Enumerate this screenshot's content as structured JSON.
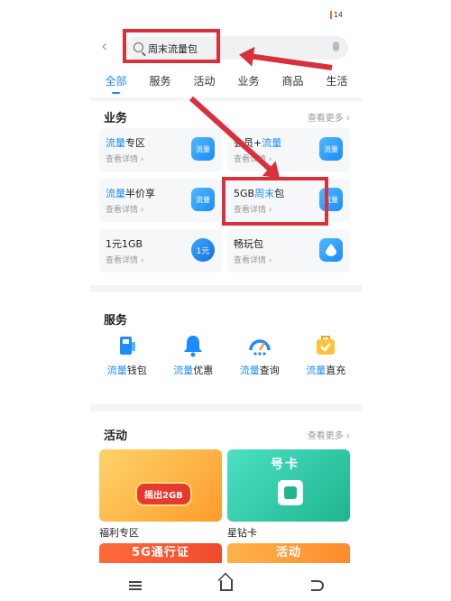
{
  "status": {
    "battery": "14"
  },
  "search": {
    "query": "周末流量包"
  },
  "tabs": [
    "全部",
    "服务",
    "活动",
    "业务",
    "商品",
    "生活"
  ],
  "business": {
    "title": "业务",
    "more": "查看更多",
    "cards": [
      {
        "hl": "流量",
        "rest": "专区",
        "detail": "查看详情",
        "icon": "流量"
      },
      {
        "pre": "会员+",
        "hl": "流量",
        "detail": "查看详情",
        "icon": "流量"
      },
      {
        "hl": "流量",
        "rest": "半价享",
        "detail": "查看详情",
        "icon": "流量"
      },
      {
        "pre": "5GB",
        "hl": "周末",
        "rest": "包",
        "detail": "查看详情",
        "icon": "流量"
      },
      {
        "pre": "1元1GB",
        "detail": "查看详情",
        "icon": "1元"
      },
      {
        "pre": "畅玩包",
        "detail": "查看详情",
        "icon": ""
      }
    ]
  },
  "service": {
    "title": "服务",
    "items": [
      {
        "hl": "流量",
        "rest": "钱包"
      },
      {
        "hl": "流量",
        "rest": "优惠"
      },
      {
        "hl": "流量",
        "rest": "查询"
      },
      {
        "hl": "流量",
        "rest": "直充"
      }
    ]
  },
  "activity": {
    "title": "活动",
    "more": "查看更多",
    "banner1_text": "摇出2GB",
    "banner2_text": "号卡",
    "card1_title": "福利专区",
    "card2_title": "星钻卡",
    "strip1": "5G通行证",
    "strip2": "活动"
  },
  "colors": {
    "accent": "#1a8cff",
    "annotation": "#d9313c"
  }
}
